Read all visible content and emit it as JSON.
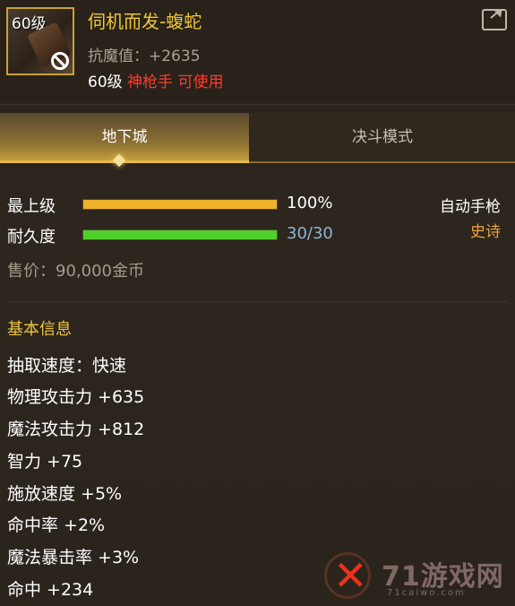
{
  "item": {
    "level_badge": "60级",
    "name": "伺机而发-蝮蛇",
    "magic_resistance": "抗魔值：+2635",
    "req_level": "60级",
    "req_class": "神枪手 可使用"
  },
  "tabs": [
    {
      "label": "地下城",
      "active": true
    },
    {
      "label": "决斗模式",
      "active": false
    }
  ],
  "bars": {
    "grade": {
      "label": "最上级",
      "value_text": "100%",
      "fraction": 1.0,
      "color": "#f0b22a"
    },
    "durability": {
      "label": "耐久度",
      "value_text": "30/30",
      "fraction": 1.0,
      "color": "#4fd12b"
    }
  },
  "weapon_type": "自动手枪",
  "rarity": "史诗",
  "rarity_color": "#f0a43a",
  "price": "售价：90,000金币",
  "basic_info": {
    "title": "基本信息",
    "lines": [
      "抽取速度：快速",
      "物理攻击力 +635",
      "魔法攻击力 +812",
      "智力 +75",
      "施放速度 +5%",
      "命中率 +2%",
      "魔法暴击率 +3%",
      "命中 +234"
    ]
  },
  "watermark": {
    "text": "71游戏网",
    "sub": "71caiwo.com"
  }
}
